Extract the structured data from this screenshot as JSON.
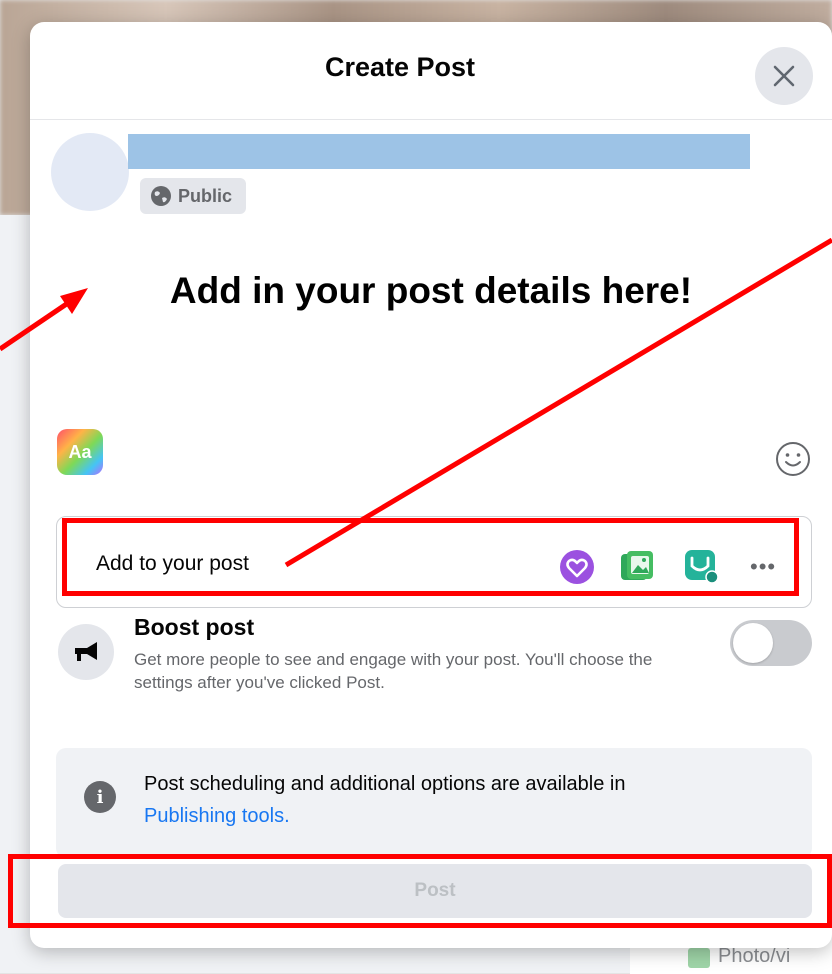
{
  "modal": {
    "title": "Create Post"
  },
  "composer": {
    "privacy": "Public",
    "annotation_text": "Add in your post details here!"
  },
  "add_to_post": {
    "label": "Add to your post",
    "icons": [
      "feeling-icon",
      "photo-video-icon",
      "shop-icon",
      "more-options-icon"
    ],
    "more_label": "•••"
  },
  "boost": {
    "title": "Boost post",
    "description": "Get more people to see and engage with your post. You'll choose the settings after you've clicked Post.",
    "enabled": false
  },
  "info": {
    "text": "Post scheduling and additional options are available in",
    "link": "Publishing tools."
  },
  "post_button": {
    "label": "Post"
  },
  "background": {
    "partial_label": "Photo/vi"
  },
  "colors": {
    "annotation": "#ff0000",
    "link": "#1877f2",
    "name_placeholder": "#9dc3e6"
  }
}
